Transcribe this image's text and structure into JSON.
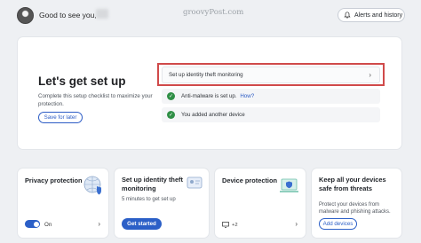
{
  "header": {
    "greeting": "Good to see you,",
    "watermark": "groovyPost.com",
    "alerts_label": "Alerts and history"
  },
  "setup": {
    "title": "Let's get set up",
    "description": "Complete this setup checklist to maximize your protection.",
    "save_label": "Save for later",
    "primary_task": "Set up identity theft monitoring",
    "tasks": [
      {
        "text": "Anti-malware is set up.",
        "link": "How?"
      },
      {
        "text": "You added another device",
        "link": ""
      }
    ]
  },
  "cards": [
    {
      "title": "Privacy protection",
      "toggle_label": "On"
    },
    {
      "title": "Set up identity theft monitoring",
      "subtitle": "5 minutes to get set up",
      "button": "Get started"
    },
    {
      "title": "Device protection",
      "device_count": "+2"
    },
    {
      "title": "Keep all your devices safe from threats",
      "subtitle": "Protect your devices from malware and phishing attacks.",
      "button": "Add devices"
    }
  ],
  "colors": {
    "accent": "#2b5fc7",
    "success": "#2f8f46",
    "highlight": "#d04a4a"
  }
}
